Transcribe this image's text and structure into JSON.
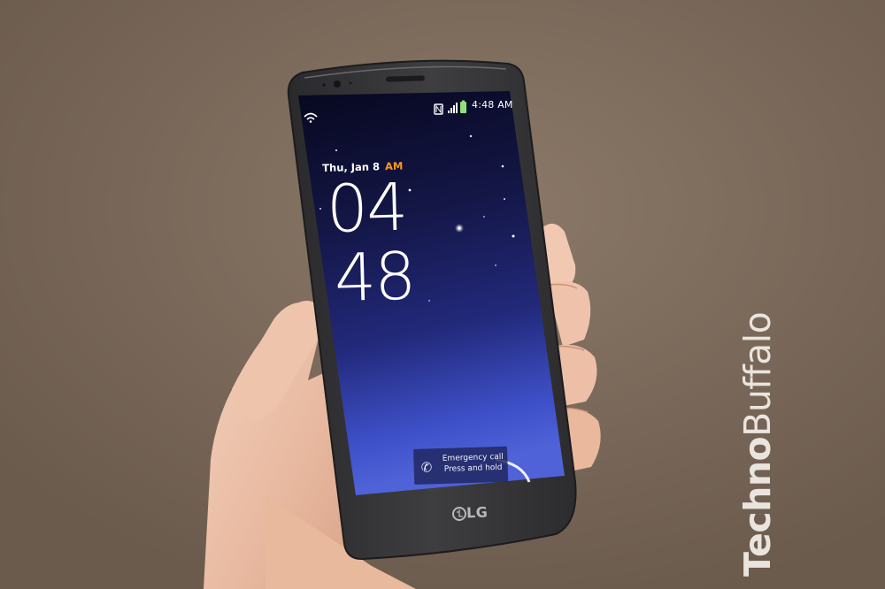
{
  "status_bar": {
    "time": "4:48 AM"
  },
  "lockscreen": {
    "date": "Thu, Jan 8",
    "ampm": "AM",
    "clock_hours": "04",
    "clock_minutes": "48",
    "emergency_line1": "Emergency call",
    "emergency_line2": "Press and hold"
  },
  "device": {
    "brand": "LG"
  },
  "watermark": {
    "part1": "Techno",
    "part2": "Buffalo"
  },
  "colors": {
    "background_wall": "#7a6858",
    "screen_top": "#0a0b2a",
    "screen_bottom": "#4a5cd6",
    "phone_body": "#3a3a3c",
    "ampm_accent": "#ff9a1a",
    "skin": "#efc7b1"
  },
  "icons": [
    "wifi-icon",
    "nfc-icon",
    "signal-icon",
    "battery-icon",
    "phone-icon",
    "lg-logo-icon",
    "camera-icon",
    "speaker-grille"
  ]
}
